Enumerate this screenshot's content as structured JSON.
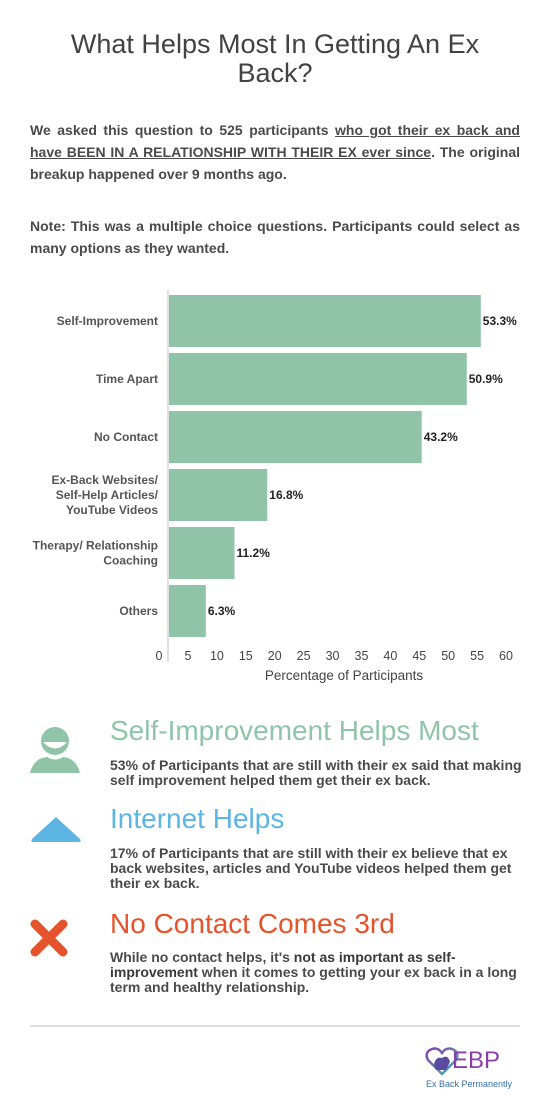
{
  "header": {
    "title": "What Helps Most In Getting An Ex Back?"
  },
  "intro": {
    "text_before": "We asked this question to 525 participants ",
    "underlined": "who got their ex back and have BEEN IN A RELATIONSHIP WITH THEIR EX ever since",
    "text_after": ". The original breakup happened over 9 months ago."
  },
  "note": "Note: This was a multiple choice questions. Participants could select as many options as they wanted.",
  "chart_data": {
    "type": "bar",
    "orientation": "horizontal",
    "categories": [
      [
        "Self-Improvement"
      ],
      [
        "Time Apart"
      ],
      [
        "No Contact"
      ],
      [
        "Ex-Back Websites/",
        "Self-Help Articles/",
        "YouTube Videos"
      ],
      [
        "Therapy/ Relationship",
        "Coaching"
      ],
      [
        "Others"
      ]
    ],
    "values": [
      53.3,
      50.9,
      43.2,
      16.8,
      11.2,
      6.3
    ],
    "value_labels": [
      "53.3%",
      "50.9%",
      "43.2%",
      "16.8%",
      "11.2%",
      "6.3%"
    ],
    "title": "",
    "xlabel": "Percentage of Participants",
    "ylabel": "",
    "xlim": [
      0,
      60
    ],
    "xticks": [
      0,
      5,
      10,
      15,
      20,
      25,
      30,
      35,
      40,
      45,
      50,
      55,
      60
    ],
    "grid": false,
    "legend": "none",
    "bar_color": "#8fc4a8"
  },
  "insights": [
    {
      "icon": "person-icon",
      "heading": "Self-Improvement Helps Most",
      "color": "#8fc4a8",
      "body": "53% of Participants that are still with their ex said that making self improvement helped them get their ex back."
    },
    {
      "icon": "triangle-up-icon",
      "heading": "Internet Helps",
      "color": "#5db5e3",
      "body": "17% of Participants that are still with their ex believe that ex back websites, articles and YouTube videos helped them get their ex back."
    },
    {
      "icon": "x-icon",
      "heading": "No Contact Comes 3rd",
      "color": "#e4532b",
      "body_before": "While no contact helps, it's ",
      "body_bold": "not as important as self-improvement",
      "body_after": " when it comes to getting your ex back in a long term and healthy relationship."
    }
  ],
  "footer": {
    "logo_text": "EBP",
    "logo_tagline": "Ex Back Permanently"
  }
}
